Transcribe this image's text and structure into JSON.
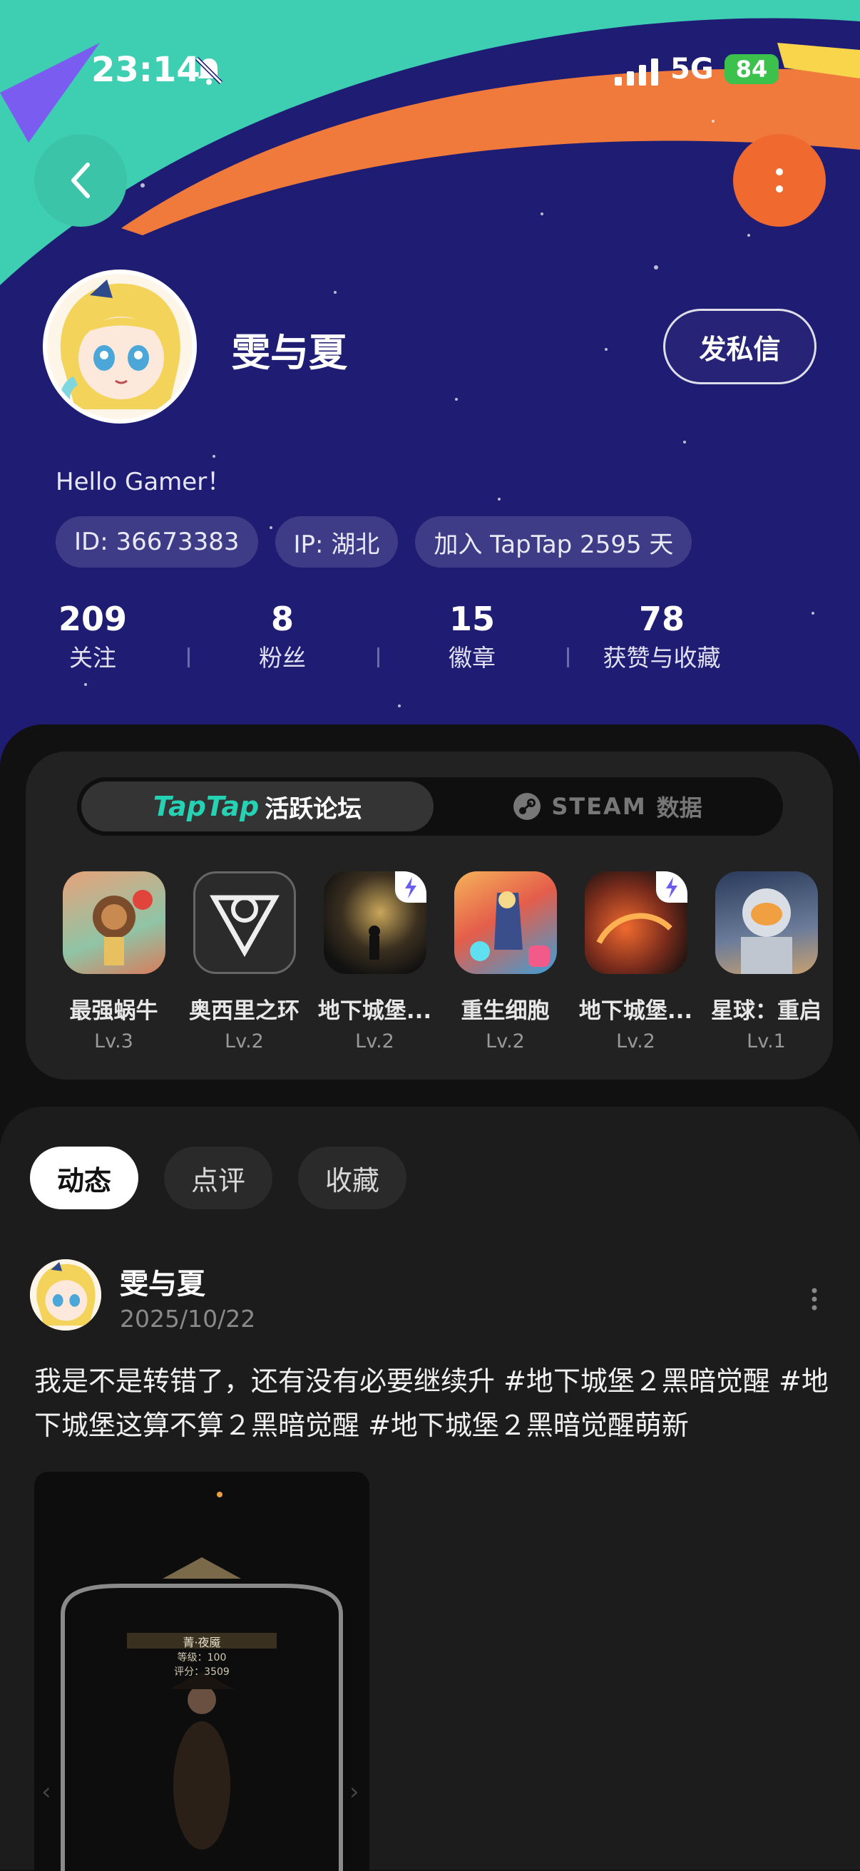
{
  "status_bar": {
    "time": "23:14",
    "network": "5G",
    "battery": "84"
  },
  "profile": {
    "name": "雯与夏",
    "dm_button": "发私信",
    "bio": "Hello Gamer！",
    "chips": [
      "ID: 36673383",
      "IP: 湖北",
      "加入 TapTap 2595 天"
    ],
    "stats": [
      {
        "value": "209",
        "label": "关注"
      },
      {
        "value": "8",
        "label": "粉丝"
      },
      {
        "value": "15",
        "label": "徽章"
      },
      {
        "value": "78",
        "label": "获赞与收藏"
      }
    ]
  },
  "segment": {
    "active_logo": "TapTap",
    "active_label": "活跃论坛",
    "inactive_steam": "STEAM",
    "inactive_label": "数据"
  },
  "games": [
    {
      "name": "最强蜗牛",
      "level": "Lv.3"
    },
    {
      "name": "奥西里之环",
      "level": "Lv.2"
    },
    {
      "name": "地下城堡...",
      "level": "Lv.2"
    },
    {
      "name": "重生细胞",
      "level": "Lv.2"
    },
    {
      "name": "地下城堡...",
      "level": "Lv.2"
    },
    {
      "name": "星球：重启",
      "level": "Lv.1"
    }
  ],
  "feed": {
    "tabs": [
      "动态",
      "点评",
      "收藏"
    ],
    "post": {
      "author": "雯与夏",
      "date": "2025/10/22",
      "text": "我是不是转错了，还有没有必要继续升 #地下城堡２黑暗觉醒 #地下城堡这算不算２黑暗觉醒 #地下城堡２黑暗觉醒萌新",
      "image_caption": [
        "菁·夜魇",
        "等级：100",
        "评分：3509"
      ]
    }
  },
  "colors": {
    "header_bg": "#1f1c73",
    "teal": "#3cc4a9",
    "orange": "#f06a2f",
    "taptap": "#25d2b4"
  }
}
